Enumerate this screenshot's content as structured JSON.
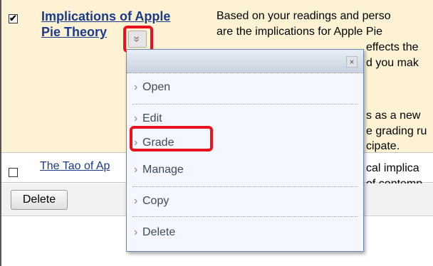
{
  "row1": {
    "checked": true,
    "title_line1": "Implications of Apple",
    "title_line2": "Pie Theory",
    "desc_visible": [
      "Based on your readings and perso",
      "are the implications for Apple Pie",
      "effects the",
      "d you mak",
      "s as a new",
      "e grading ru",
      "cipate."
    ]
  },
  "row2": {
    "checked": false,
    "title": "The Tao of Ap",
    "desc_visible": [
      "cal implica",
      "of contemp"
    ]
  },
  "footer": {
    "delete_label": "Delete"
  },
  "menu": {
    "close_glyph": "×",
    "items": [
      {
        "label": "Open"
      },
      {
        "label": "Edit"
      },
      {
        "label": "Grade"
      },
      {
        "label": "Manage"
      },
      {
        "label": "Copy"
      },
      {
        "label": "Delete"
      }
    ],
    "chevron_glyph": "›"
  },
  "colors": {
    "highlight": "#e8131e",
    "link": "#1a3a8c",
    "row_highlight_bg": "#fdf3d4"
  },
  "icons": {
    "row_menu_toggle": "double-chevron-down-icon"
  }
}
